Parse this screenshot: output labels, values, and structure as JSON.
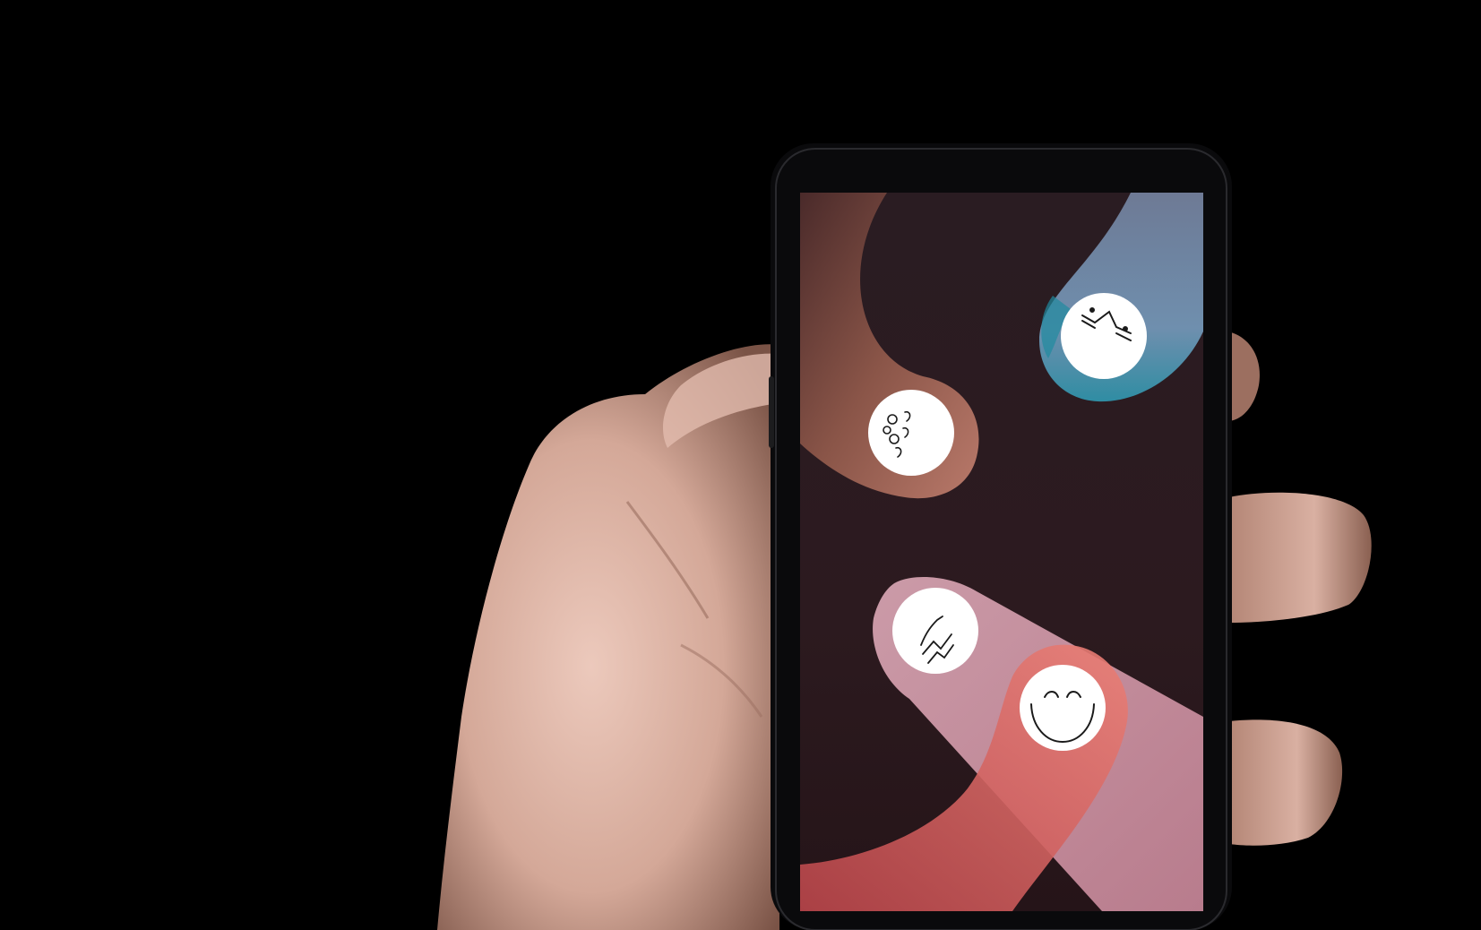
{
  "scene": {
    "description_free": true,
    "background_color": "#000000"
  },
  "colors": {
    "skin_light": "#e8c2b4",
    "skin_mid": "#c99b8c",
    "skin_shadow": "#8f6456",
    "phone_bezel": "#0a0a0c",
    "screen_bg": "#2b1a1f",
    "blob_brown": "#a8705f",
    "blob_teal": "#3f8fa3",
    "blob_pink": "#d7a1ad",
    "blob_coral": "#e0706d",
    "bubble_fill": "#ffffff",
    "glyph_stroke": "#1a1a1a"
  },
  "bubbles": [
    {
      "name": "bubble-teal",
      "icon": "bird-line-icon",
      "interactable": true
    },
    {
      "name": "bubble-brown",
      "icon": "swirl-dots-icon",
      "interactable": true
    },
    {
      "name": "bubble-pink",
      "icon": "zigzag-lines-icon",
      "interactable": true
    },
    {
      "name": "bubble-coral",
      "icon": "smile-face-icon",
      "interactable": true
    }
  ]
}
